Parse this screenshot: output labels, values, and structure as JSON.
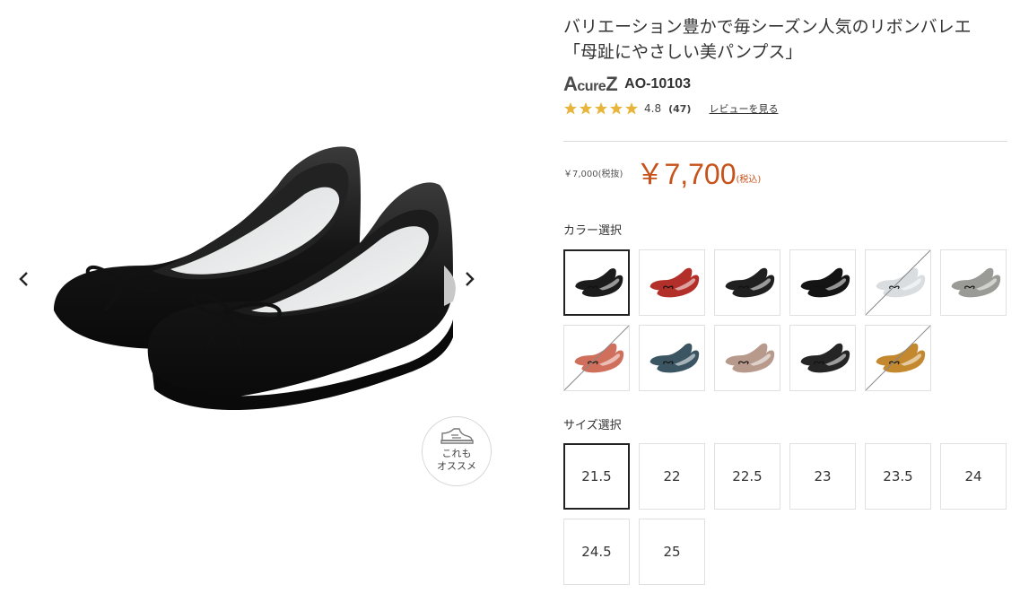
{
  "product": {
    "title_line1": "バリエーション豊かで毎シーズン人気のリボンバレエ",
    "title_line2": "「母趾にやさしい美パンプス」",
    "brand": {
      "logo_big": "A",
      "logo_mid": "cure",
      "logo_end": "Z"
    },
    "model_number": "AO-10103",
    "rating": {
      "score": "4.8",
      "count": "(47)",
      "stars": 5,
      "review_link": "レビューを見る",
      "star_color": "#e8b43a"
    },
    "price": {
      "tax_excluded": "￥7,000(税抜)",
      "tax_included": "￥7,700",
      "tax_note": "(税込)",
      "accent_color": "#c7521a"
    }
  },
  "gallery": {
    "prev_icon": "chevron-left-icon",
    "next_icon": "chevron-right-icon",
    "recommend": {
      "line1": "これも",
      "line2": "オススメ"
    }
  },
  "color_select": {
    "label": "カラー選択",
    "swatches": [
      {
        "color": "#1c1c1c",
        "selected": true,
        "soldout": false
      },
      {
        "color": "#b3302a",
        "selected": false,
        "soldout": false
      },
      {
        "color": "#202020",
        "selected": false,
        "soldout": false
      },
      {
        "color": "#141414",
        "selected": false,
        "soldout": false
      },
      {
        "color": "#d9dde0",
        "selected": false,
        "soldout": true
      },
      {
        "color": "#9a9a96",
        "selected": false,
        "soldout": false
      },
      {
        "color": "#d0705c",
        "selected": false,
        "soldout": true
      },
      {
        "color": "#3b5563",
        "selected": false,
        "soldout": false
      },
      {
        "color": "#b89a8c",
        "selected": false,
        "soldout": false
      },
      {
        "color": "#252525",
        "selected": false,
        "soldout": false
      },
      {
        "color": "#c4892e",
        "selected": false,
        "soldout": true
      }
    ]
  },
  "size_select": {
    "label": "サイズ選択",
    "sizes": [
      {
        "label": "21.5",
        "selected": true
      },
      {
        "label": "22",
        "selected": false
      },
      {
        "label": "22.5",
        "selected": false
      },
      {
        "label": "23",
        "selected": false
      },
      {
        "label": "23.5",
        "selected": false
      },
      {
        "label": "24",
        "selected": false
      },
      {
        "label": "24.5",
        "selected": false
      },
      {
        "label": "25",
        "selected": false
      }
    ]
  }
}
